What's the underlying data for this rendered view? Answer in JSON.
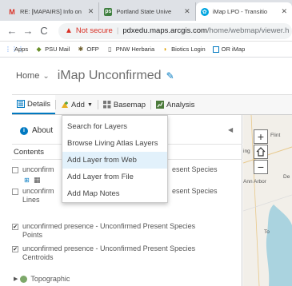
{
  "tabs": [
    {
      "title": "RE: [MAPAIRS] Info on",
      "icon": "gmail-icon",
      "color": "#d93025"
    },
    {
      "title": "Portland State Unive",
      "icon": "psu-icon",
      "color": "#3f7f3f"
    },
    {
      "title": "iMap LPO - Transitio",
      "icon": "atom-icon",
      "color": "#00a5e0"
    }
  ],
  "address": {
    "not_secure": "Not secure",
    "host": "pdxedu.maps.arcgis.com",
    "path": "/home/webmap/viewer.h"
  },
  "bookmarks": [
    {
      "label": "Apps",
      "icon": "apps-grid-icon"
    },
    {
      "label": "PSU Mail",
      "icon": "psu-leaf-icon"
    },
    {
      "label": "OFP",
      "icon": "ofp-icon"
    },
    {
      "label": "PNW Herbaria",
      "icon": "page-icon"
    },
    {
      "label": "Biotics Login",
      "icon": "biotics-icon"
    },
    {
      "label": "OR iMap",
      "icon": "imap-icon"
    }
  ],
  "breadcrumb": {
    "home": "Home"
  },
  "map_title": "iMap Unconfirmed",
  "toolbar": {
    "details": "Details",
    "add": "Add",
    "basemap": "Basemap",
    "analysis": "Analysis"
  },
  "panel": {
    "about": "About",
    "contents": "Contents",
    "layers": [
      {
        "line1": "unconfirm",
        "line1_right": "esent Species",
        "line2": "",
        "checked": false
      },
      {
        "line1": "unconfirm",
        "line1_right": "esent Species",
        "line2": "Lines",
        "checked": false
      },
      {
        "line1": "unconfirmed presence - Unconfirmed Present Species",
        "line2": "Points",
        "checked": true
      },
      {
        "line1": "unconfirmed presence - Unconfirmed Present Species",
        "line2": "Centroids",
        "checked": true
      }
    ],
    "basemap_layer": "Topographic"
  },
  "add_menu": {
    "items": [
      "Search for Layers",
      "Browse Living Atlas Layers",
      "Add Layer from Web",
      "Add Layer from File",
      "Add Map Notes"
    ],
    "highlighted_index": 2
  },
  "map": {
    "labels": [
      "Flint",
      "ing",
      "Ann Arbor",
      "De",
      "To"
    ]
  }
}
